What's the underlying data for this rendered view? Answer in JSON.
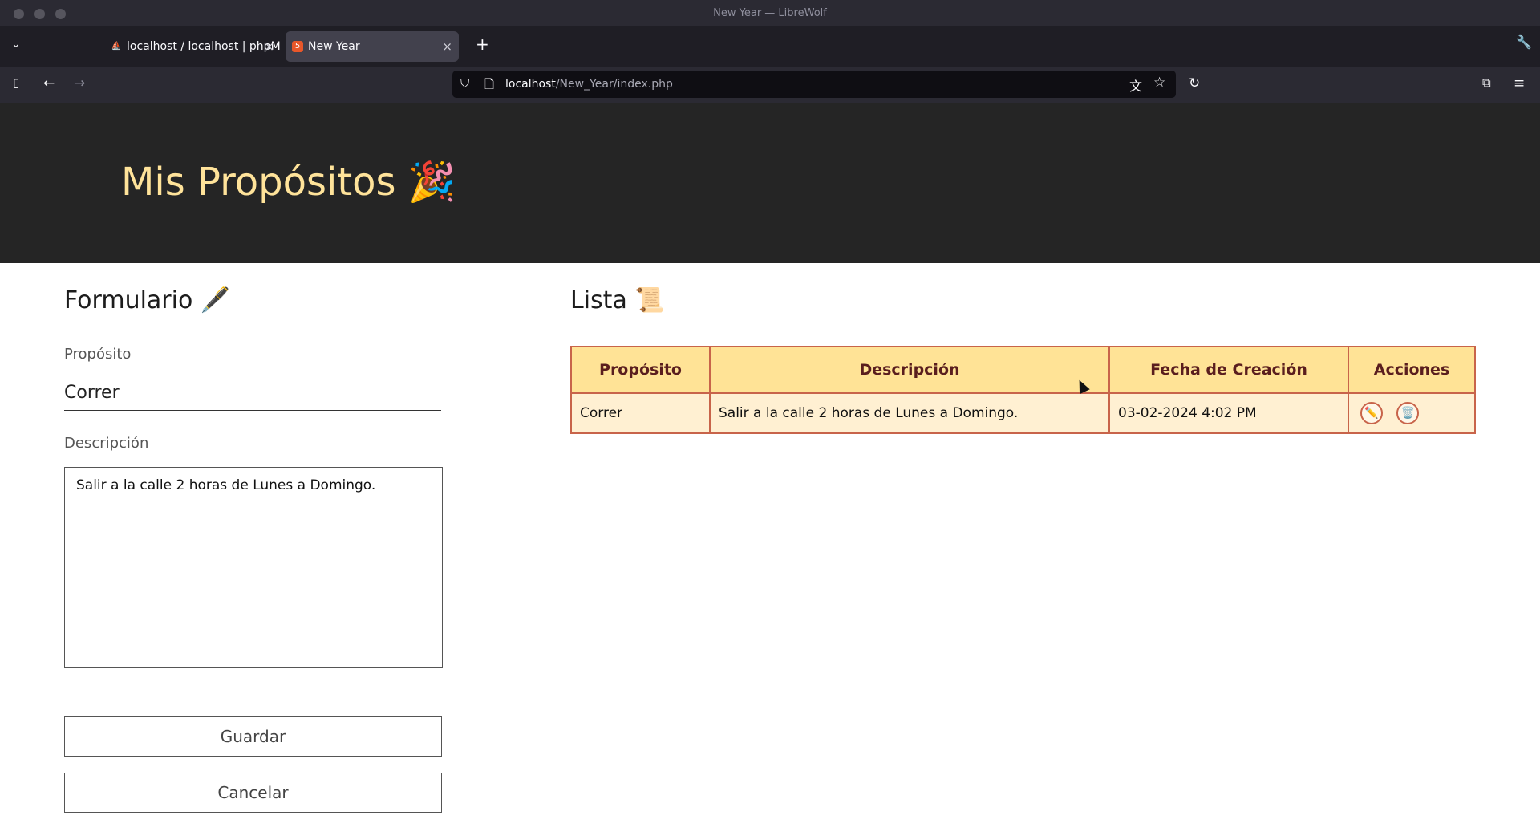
{
  "window": {
    "title": "New Year — LibreWolf"
  },
  "tabs": [
    {
      "label": "localhost / localhost | phpMyAdmin",
      "active": false
    },
    {
      "label": "New Year",
      "active": true
    }
  ],
  "address_bar": {
    "host": "localhost",
    "path": "/New_Year/index.php"
  },
  "header": {
    "title": "Mis Propósitos 🎉"
  },
  "form": {
    "heading": "Formulario 🖋️",
    "proposito_label": "Propósito",
    "proposito_value": "Correr",
    "descripcion_label": "Descripción",
    "descripcion_value": "Salir a la calle 2 horas de Lunes a Domingo.",
    "save_label": "Guardar",
    "cancel_label": "Cancelar"
  },
  "list": {
    "heading": "Lista 📜",
    "columns": [
      "Propósito",
      "Descripción",
      "Fecha de Creación",
      "Acciones"
    ],
    "rows": [
      {
        "proposito": "Correr",
        "descripcion": "Salir a la calle 2 horas de Lunes a Domingo.",
        "fecha": "03-02-2024 4:02 PM",
        "edit_icon": "✏️",
        "delete_icon": "🗑️"
      }
    ]
  },
  "colors": {
    "header_bg": "#252525",
    "header_text": "#ffe39a",
    "table_head_bg": "#ffe396",
    "table_row_bg": "#fff0d2",
    "table_border": "#c8644a",
    "table_head_text": "#5a1e1e"
  }
}
